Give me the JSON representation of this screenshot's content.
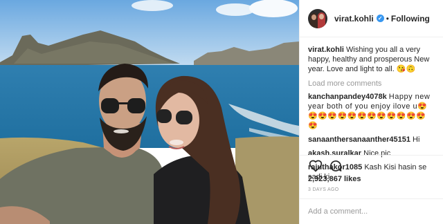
{
  "header": {
    "username": "virat.kohli",
    "verified_glyph": "✓",
    "separator": "•",
    "follow_status": "Following"
  },
  "caption": {
    "username": "virat.kohli",
    "text": "Wishing you all a very happy, healthy and prosperous New year. Love and light to all. 😘🙃"
  },
  "load_more": "Load more comments",
  "comments": [
    {
      "username": "kanchanpandey4078k",
      "text": "Happy new year both of you enjoy ilove u😍😍😍😍😍😍😍😍😍😍😍😍😍😍"
    },
    {
      "username": "sanaanthersanaanther45151",
      "text": "Hi"
    },
    {
      "username": "akash.suralkar",
      "text": "Nice.pic"
    },
    {
      "username": "rajuthakor1085",
      "text": "Kash Kisi hasin se sadi ki"
    }
  ],
  "likes": "2,923,867 likes",
  "time": "3 DAYS AGO",
  "add_comment_placeholder": "Add a comment...",
  "icons": {
    "like": "heart-icon",
    "comment": "comment-bubble-icon",
    "verified": "verified-badge-icon"
  },
  "colors": {
    "verified_blue": "#3897f0",
    "muted_gray": "#999999",
    "text": "#262626",
    "divider": "#efefef"
  }
}
